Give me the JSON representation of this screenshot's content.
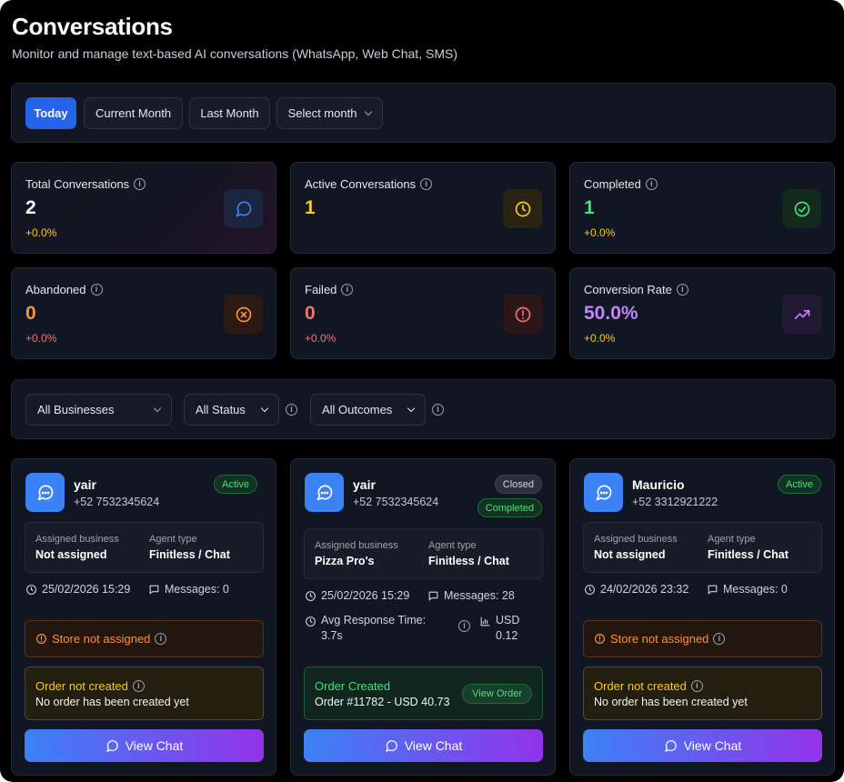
{
  "page": {
    "title": "Conversations",
    "subtitle": "Monitor and manage text-based AI conversations (WhatsApp, Web Chat, SMS)"
  },
  "period_filters": {
    "today": "Today",
    "current_month": "Current Month",
    "last_month": "Last Month",
    "select_month": "Select month",
    "active": "Today"
  },
  "stats": {
    "total": {
      "label": "Total Conversations",
      "value": "2",
      "change": "+0.0%",
      "icon": "chat-bubble-icon",
      "color": "#ffffff"
    },
    "active": {
      "label": "Active Conversations",
      "value": "1",
      "change": "",
      "icon": "clock-icon",
      "color": "#facc15"
    },
    "completed": {
      "label": "Completed",
      "value": "1",
      "change": "+0.0%",
      "icon": "check-circle-icon",
      "color": "#4ade80"
    },
    "abandoned": {
      "label": "Abandoned",
      "value": "0",
      "change": "+0.0%",
      "icon": "x-circle-icon",
      "color": "#fb923c"
    },
    "failed": {
      "label": "Failed",
      "value": "0",
      "change": "+0.0%",
      "icon": "alert-circle-icon",
      "color": "#f87171"
    },
    "conversion": {
      "label": "Conversion Rate",
      "value": "50.0%",
      "change": "+0.0%",
      "icon": "trending-up-icon",
      "color": "#c084fc"
    }
  },
  "filters": {
    "business": "All Businesses",
    "status": "All Status",
    "outcomes": "All Outcomes"
  },
  "labels": {
    "assigned_business": "Assigned business",
    "agent_type": "Agent type",
    "view_chat": "View Chat",
    "view_order": "View Order",
    "avg_response": "Avg Response Time:",
    "store_not_assigned": "Store not assigned",
    "order_not_created": "Order not created",
    "no_order": "No order has been created yet",
    "order_created": "Order Created"
  },
  "conversations": [
    {
      "name": "yair",
      "phone": "+52 7532345624",
      "status": "Active",
      "business": "Not assigned",
      "agent": "Finitless / Chat",
      "date": "25/02/2026 15:29",
      "messages": "Messages: 0"
    },
    {
      "name": "yair",
      "phone": "+52 7532345624",
      "status": "Closed",
      "outcome": "Completed",
      "business": "Pizza Pro's",
      "agent": "Finitless / Chat",
      "date": "25/02/2026 15:29",
      "messages": "Messages: 28",
      "avg_response": "3.7s",
      "cost_currency": "USD",
      "cost_value": "0.12",
      "order": "Order #11782 - USD 40.73"
    },
    {
      "name": "Mauricio",
      "phone": "+52 3312921222",
      "status": "Active",
      "business": "Not assigned",
      "agent": "Finitless / Chat",
      "date": "24/02/2026 23:32",
      "messages": "Messages: 0"
    }
  ]
}
